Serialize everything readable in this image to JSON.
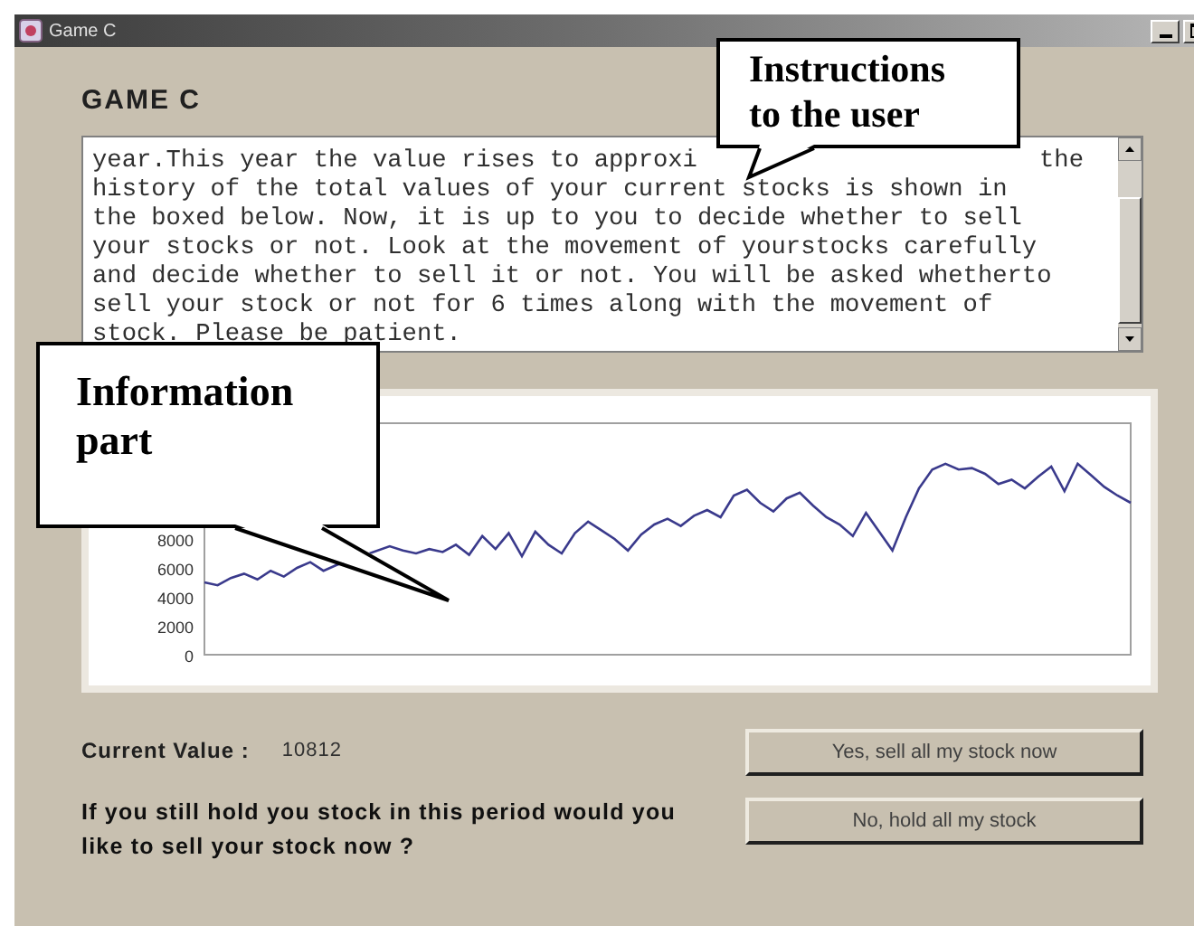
{
  "window": {
    "title": "Game C"
  },
  "heading": "GAME C",
  "instructions": {
    "lines": [
      {
        "left": "year.This year the value rises to approxi",
        "right": "the"
      },
      {
        "left": "history of the total values of your current stocks is shown in"
      },
      {
        "left": "the boxed below. Now, it is up to you to decide whether to sell"
      },
      {
        "left": "your stocks or not. Look at the movement of yourstocks carefully"
      },
      {
        "left": "and decide whether to sell it or not. You will be asked whetherto"
      },
      {
        "left": "sell your stock or not for 6 times along with the movement of"
      },
      {
        "left": "stock. Please be patient."
      }
    ]
  },
  "chart_data": {
    "type": "line",
    "ylim": [
      0,
      16000
    ],
    "yticks": [
      0,
      2000,
      4000,
      6000,
      8000
    ],
    "series": [
      {
        "color": "#3a3a8c",
        "values": [
          5000,
          4800,
          5300,
          5600,
          5200,
          5800,
          5400,
          6000,
          6400,
          5800,
          6200,
          null,
          null,
          null,
          7500,
          7200,
          7000,
          7300,
          7100,
          7600,
          6900,
          8200,
          7300,
          8400,
          6800,
          8500,
          7600,
          7000,
          8400,
          9200,
          8600,
          8000,
          7200,
          8300,
          9000,
          9400,
          8900,
          9600,
          10000,
          9500,
          11000,
          11400,
          10500,
          9900,
          10800,
          11200,
          10300,
          9500,
          9000,
          8200,
          9800,
          8500,
          7200,
          9500,
          11500,
          12800,
          13200,
          12800,
          12900,
          12500,
          11800,
          12100,
          11500,
          12300,
          13000,
          11300,
          13200,
          12400,
          11600,
          11000,
          10500
        ]
      }
    ]
  },
  "current_value": {
    "label": "Current Value :",
    "value": "10812"
  },
  "question": "If you still hold you stock in this period would you like to sell your stock now ?",
  "buttons": [
    "Yes, sell all my stock now",
    "No, hold all my stock"
  ],
  "callouts": [
    {
      "text": "Instructions to the user"
    },
    {
      "text": "Information part"
    }
  ]
}
